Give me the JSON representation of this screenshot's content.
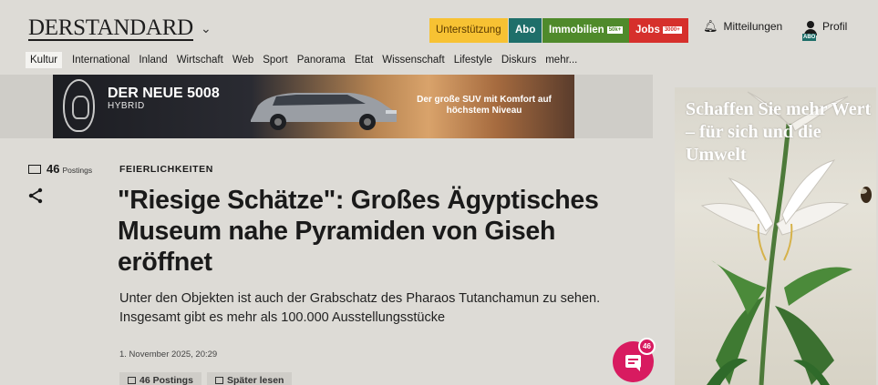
{
  "header": {
    "logo": "DERSTANDARD",
    "logo_chevron": "⌄",
    "support_label": "Unterstützung",
    "abo_label": "Abo",
    "immo_label": "Immobilien",
    "immo_badge": "50k+",
    "jobs_label": "Jobs",
    "jobs_badge": "3000+",
    "notifications_label": "Mitteilungen",
    "profile_label": "Profil",
    "profile_badge": "ABO",
    "colors": {
      "support": "#f7c233",
      "abo": "#1f6f6a",
      "immo": "#4f8a2b",
      "jobs": "#d6302c"
    }
  },
  "nav": {
    "items": [
      "Kultur",
      "International",
      "Inland",
      "Wirtschaft",
      "Web",
      "Sport",
      "Panorama",
      "Etat",
      "Wissenschaft",
      "Lifestyle",
      "Diskurs",
      "mehr..."
    ],
    "active": "Kultur"
  },
  "banner": {
    "brand": "PEUGEOT",
    "title": "DER NEUE 5008",
    "subtitle": "HYBRID",
    "tagline": "Der große SUV mit Komfort auf höchstem Niveau"
  },
  "side_ad": {
    "text": "Schaffen Sie mehr Wert – für sich und die Umwelt"
  },
  "article": {
    "postings_count": "46",
    "postings_label": "Postings",
    "kicker": "FEIERLICHKEITEN",
    "headline": "\"Riesige Schätze\": Großes Ägyptisches Museum nahe Pyramiden von Giseh eröffnet",
    "lead": "Unter den Objekten ist auch der Grabschatz des Pharaos Tutanchamun zu sehen. Insgesamt gibt es mehr als 100.000 Ausstellungsstücke",
    "date": "1. November 2025, 20:29",
    "btn_postings": "46 Postings",
    "btn_later": "Später lesen"
  },
  "fab": {
    "badge": "46",
    "icon": "chat-icon",
    "color": "#d81b60"
  }
}
